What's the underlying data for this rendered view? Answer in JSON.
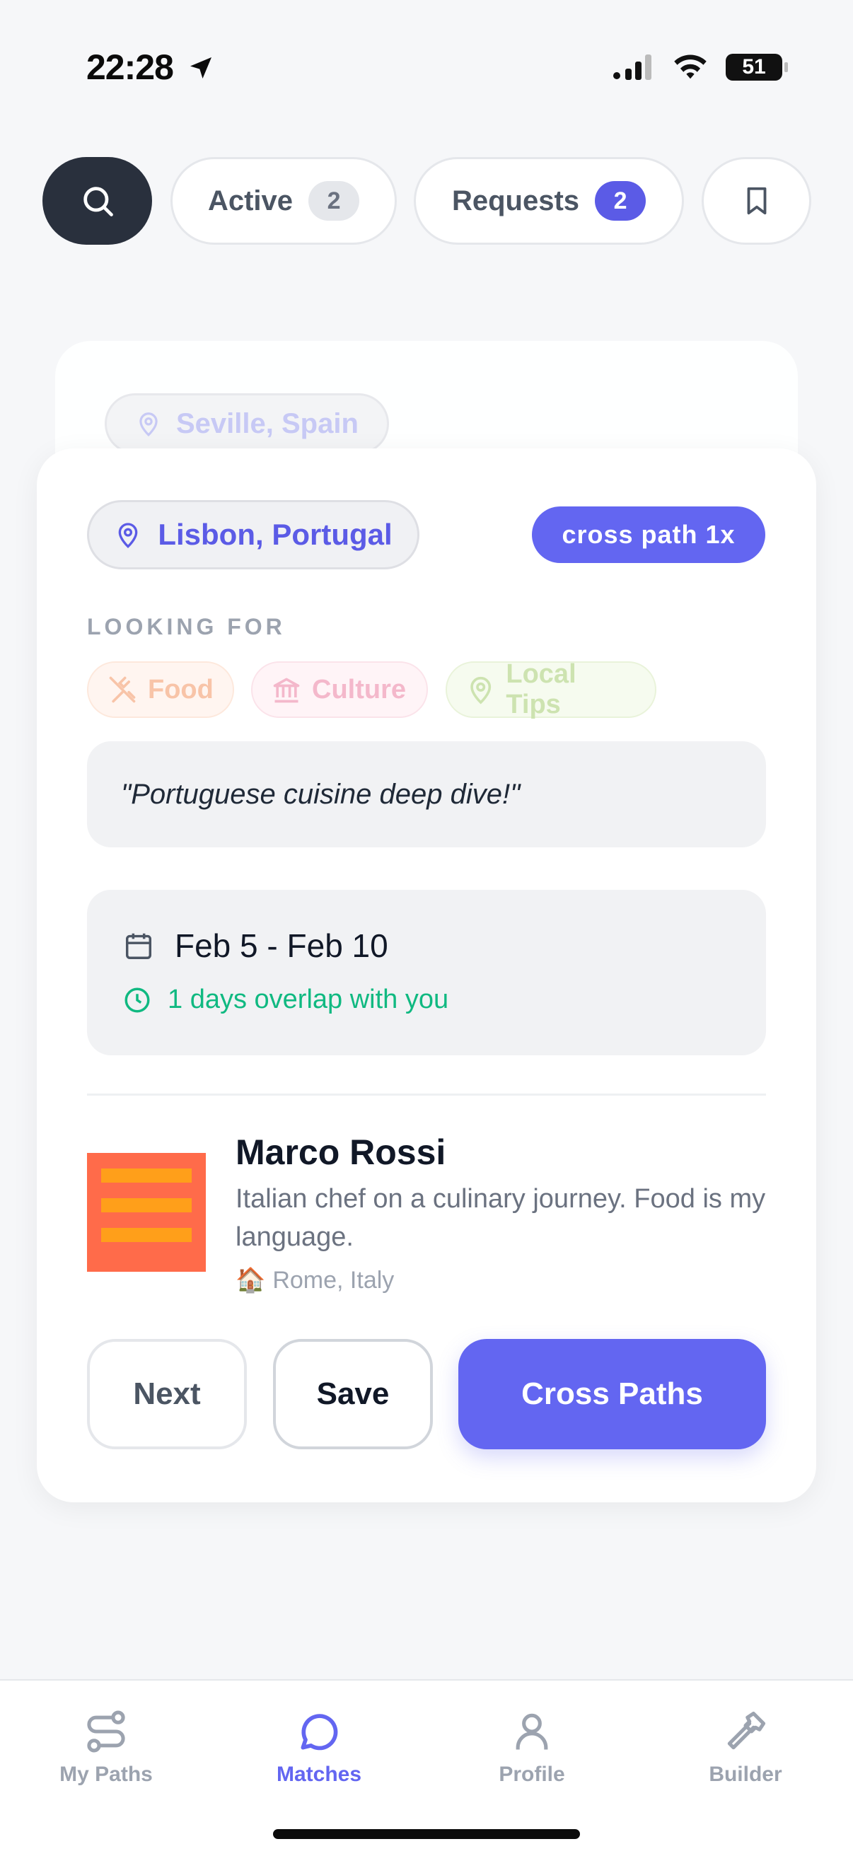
{
  "status_bar": {
    "time": "22:28",
    "battery": "51"
  },
  "top_tabs": {
    "active_label": "Active",
    "active_count": "2",
    "requests_label": "Requests",
    "requests_count": "2"
  },
  "back_card": {
    "location": "Seville, Spain"
  },
  "card": {
    "location": "Lisbon, Portugal",
    "badge": "cross path 1x",
    "looking_for_label": "LOOKING FOR",
    "tags": [
      "Food",
      "Culture",
      "Local Tips"
    ],
    "quote": "\"Portuguese cuisine deep dive!\"",
    "dates": "Feb 5 - Feb 10",
    "overlap": "1 days overlap with you",
    "user": {
      "name": "Marco Rossi",
      "bio": "Italian chef on a culinary journey. Food is my language.",
      "home_emoji": "🏠",
      "home": "Rome, Italy"
    },
    "actions": {
      "next": "Next",
      "save": "Save",
      "cross": "Cross Paths"
    }
  },
  "bottom_nav": {
    "items": [
      "My Paths",
      "Matches",
      "Profile",
      "Builder"
    ],
    "active": "Matches"
  },
  "colors": {
    "accent": "#6366f1",
    "dark": "#29303d",
    "green": "#10b981"
  }
}
